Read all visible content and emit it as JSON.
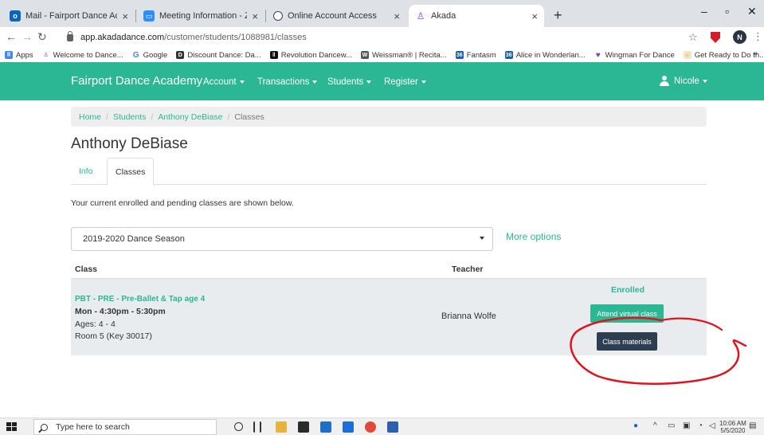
{
  "browser": {
    "tabs": [
      {
        "title": "Mail - Fairport Dance Academy -",
        "icon": "outlook-icon"
      },
      {
        "title": "Meeting Information - Zoom",
        "icon": "zoom-icon"
      },
      {
        "title": "Online Account Access",
        "icon": "globe-icon"
      },
      {
        "title": "Akada",
        "icon": "akada-icon"
      }
    ],
    "url_host": "app.akadadance.com",
    "url_path": "/customer/students/1088981/classes",
    "profile_initial": "N",
    "bookmarks": [
      "Apps",
      "Welcome to Dance...",
      "Google",
      "Discount Dance: Da...",
      "Revolution Dancew...",
      "Weissman® | Recita...",
      "Fantasm",
      "Alice in Wonderlan...",
      "Wingman For Dance",
      "Get Ready to Do th..."
    ],
    "bookmarks_overflow": "»"
  },
  "site": {
    "brand": "Fairport Dance Academy",
    "nav": [
      "Account",
      "Transactions",
      "Students",
      "Register"
    ],
    "user": "Nicole",
    "accent": "#2bb793"
  },
  "breadcrumb": [
    "Home",
    "Students",
    "Anthony DeBiase",
    "Classes"
  ],
  "page_title": "Anthony DeBiase",
  "tabs": [
    "Info",
    "Classes"
  ],
  "intro": "Your current enrolled and pending classes are shown below.",
  "season_select": "2019-2020 Dance Season",
  "more_options": "More options",
  "table": {
    "headers": [
      "Class",
      "Teacher"
    ],
    "rows": [
      {
        "name": "PBT - PRE - Pre-Ballet & Tap age 4",
        "time": "Mon - 4:30pm - 5:30pm",
        "ages": "Ages: 4 - 4",
        "room": "Room 5 (Key 30017)",
        "teacher": "Brianna Wolfe",
        "status": "Enrolled",
        "attend_label": "Attend virtual class",
        "materials_label": "Class materials"
      }
    ]
  },
  "taskbar": {
    "search_placeholder": "Type here to search",
    "time": "10:06 AM",
    "date": "5/5/2020"
  }
}
